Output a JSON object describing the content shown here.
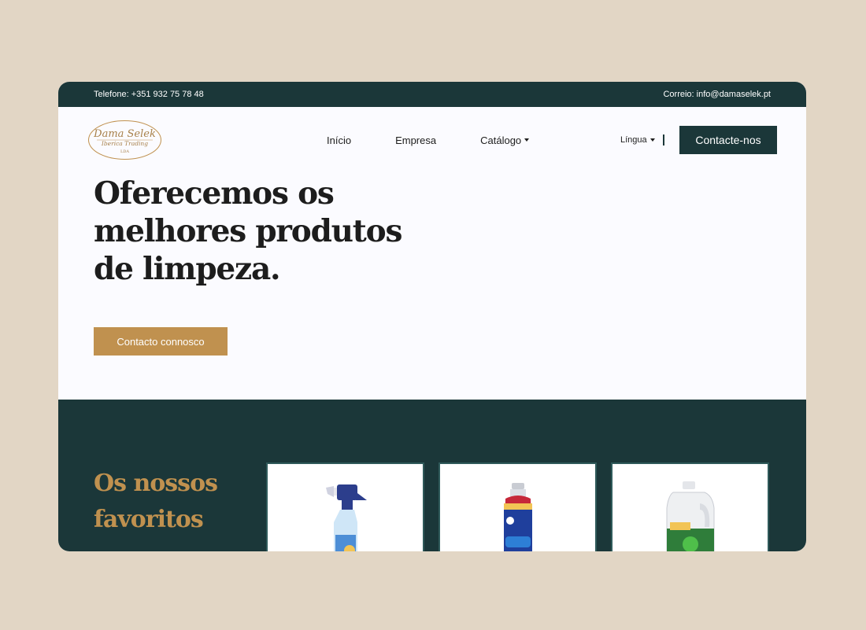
{
  "topbar": {
    "phone": "Telefone: +351 932 75 78 48",
    "email": "Correio: info@damaselek.pt"
  },
  "logo": {
    "line1": "Dama Selek",
    "line2": "Iberica Trading",
    "line3": "LDA"
  },
  "nav": {
    "items": [
      {
        "label": "Início"
      },
      {
        "label": "Empresa"
      },
      {
        "label": "Catálogo"
      }
    ],
    "language": "Língua",
    "contact_button": "Contacte-nos"
  },
  "hero": {
    "title": "Oferecemos os melhores produtos de limpeza.",
    "button": "Contacto connosco"
  },
  "favorites": {
    "title": "Os nossos favoritos",
    "products": [
      {
        "icon": "spray-bottle-icon"
      },
      {
        "icon": "rinse-aid-bottle-icon"
      },
      {
        "icon": "detergent-jug-icon"
      }
    ]
  },
  "colors": {
    "dark_green": "#1b3739",
    "gold": "#c0914f",
    "background": "#e2d6c5"
  }
}
